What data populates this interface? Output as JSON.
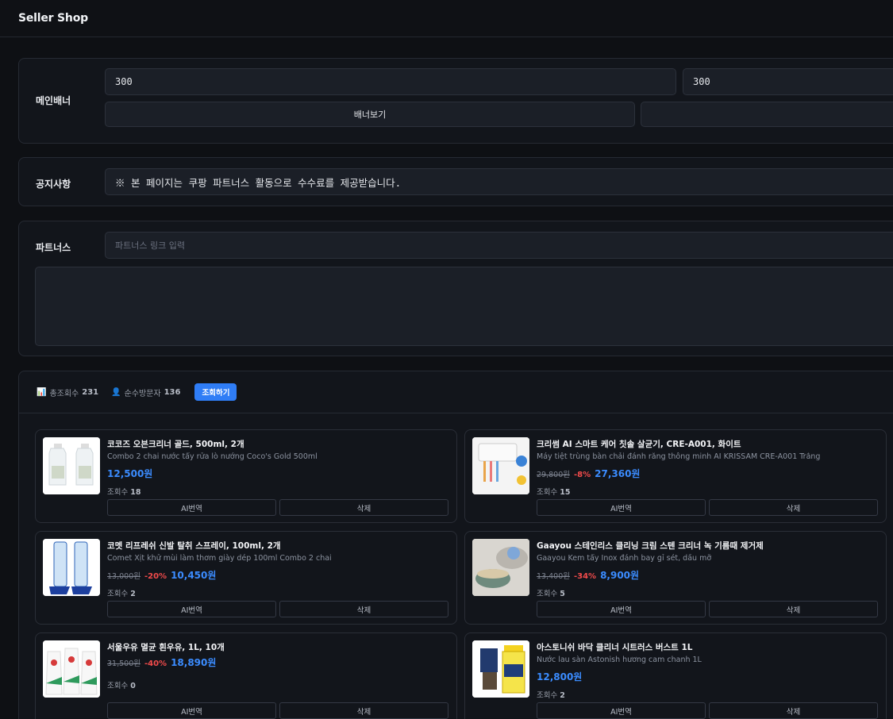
{
  "app": {
    "title": "Seller Shop"
  },
  "banner": {
    "label": "메인배너",
    "width_value": "300",
    "height_value": "300",
    "view_button": "배너보기",
    "second_button": ""
  },
  "notice": {
    "label": "공지사항",
    "value": "※ 본 페이지는 쿠팡 파트너스 활동으로 수수료를 제공받습니다."
  },
  "partners": {
    "label": "파트너스",
    "placeholder": "파트너스 링크 입력",
    "textarea_value": ""
  },
  "stats": {
    "total_icon": "📊",
    "total_label": "총조회수",
    "total_value": "231",
    "visitor_icon": "👤",
    "visitor_label": "순수방문자",
    "visitor_value": "136",
    "query_button": "조회하기"
  },
  "products": [
    {
      "name": "코코즈 오븐크리너 골드, 500ml, 2개",
      "subtitle": "Combo 2 chai nước tẩy rửa lò nướng Coco's Gold 500ml",
      "original_price": "",
      "discount": "",
      "price": "12,500원",
      "views_label": "조회수",
      "views": "18",
      "ai_button": "AI번역",
      "delete_button": "삭제",
      "thumb": "spray-bottles"
    },
    {
      "name": "크리썸 AI 스마트 케어 칫솔 살균기, CRE-A001, 화이트",
      "subtitle": "Máy tiệt trùng bàn chải đánh răng thông minh AI KRISSAM CRE-A001 Trắng",
      "original_price": "29,800원",
      "discount": "-8%",
      "price": "27,360원",
      "views_label": "조회수",
      "views": "15",
      "ai_button": "AI번역",
      "delete_button": "삭제",
      "thumb": "toothbrush-sterilizer"
    },
    {
      "name": "코멧 리프레쉬 신발 탈취 스프레이, 100ml, 2개",
      "subtitle": "Comet Xịt khử mùi làm thơm giày dép 100ml Combo 2 chai",
      "original_price": "13,000원",
      "discount": "-20%",
      "price": "10,450원",
      "views_label": "조회수",
      "views": "2",
      "ai_button": "AI번역",
      "delete_button": "삭제",
      "thumb": "shoe-spray"
    },
    {
      "name": "Gaayou 스테인리스 클리닝 크림 스텐 크리너 녹 기름때 제거제",
      "subtitle": "Gaayou Kem tẩy Inox đánh bay gỉ sét, dầu mỡ",
      "original_price": "13,400원",
      "discount": "-34%",
      "price": "8,900원",
      "views_label": "조회수",
      "views": "5",
      "ai_button": "AI번역",
      "delete_button": "삭제",
      "thumb": "cleaning-cream"
    },
    {
      "name": "서울우유 멸균 흰우유, 1L, 10개",
      "subtitle": "",
      "original_price": "31,500원",
      "discount": "-40%",
      "price": "18,890원",
      "views_label": "조회수",
      "views": "0",
      "ai_button": "AI번역",
      "delete_button": "삭제",
      "thumb": "milk-cartons"
    },
    {
      "name": "아스토니쉬 바닥 클리너 시트러스 버스트 1L",
      "subtitle": "Nước lau sàn Astonish hương cam chanh 1L",
      "original_price": "",
      "discount": "",
      "price": "12,800원",
      "views_label": "조회수",
      "views": "2",
      "ai_button": "AI번역",
      "delete_button": "삭제",
      "thumb": "floor-cleaner"
    }
  ],
  "colors": {
    "accent": "#2f7df6",
    "price": "#3b8cff",
    "discount": "#f24b4b"
  }
}
